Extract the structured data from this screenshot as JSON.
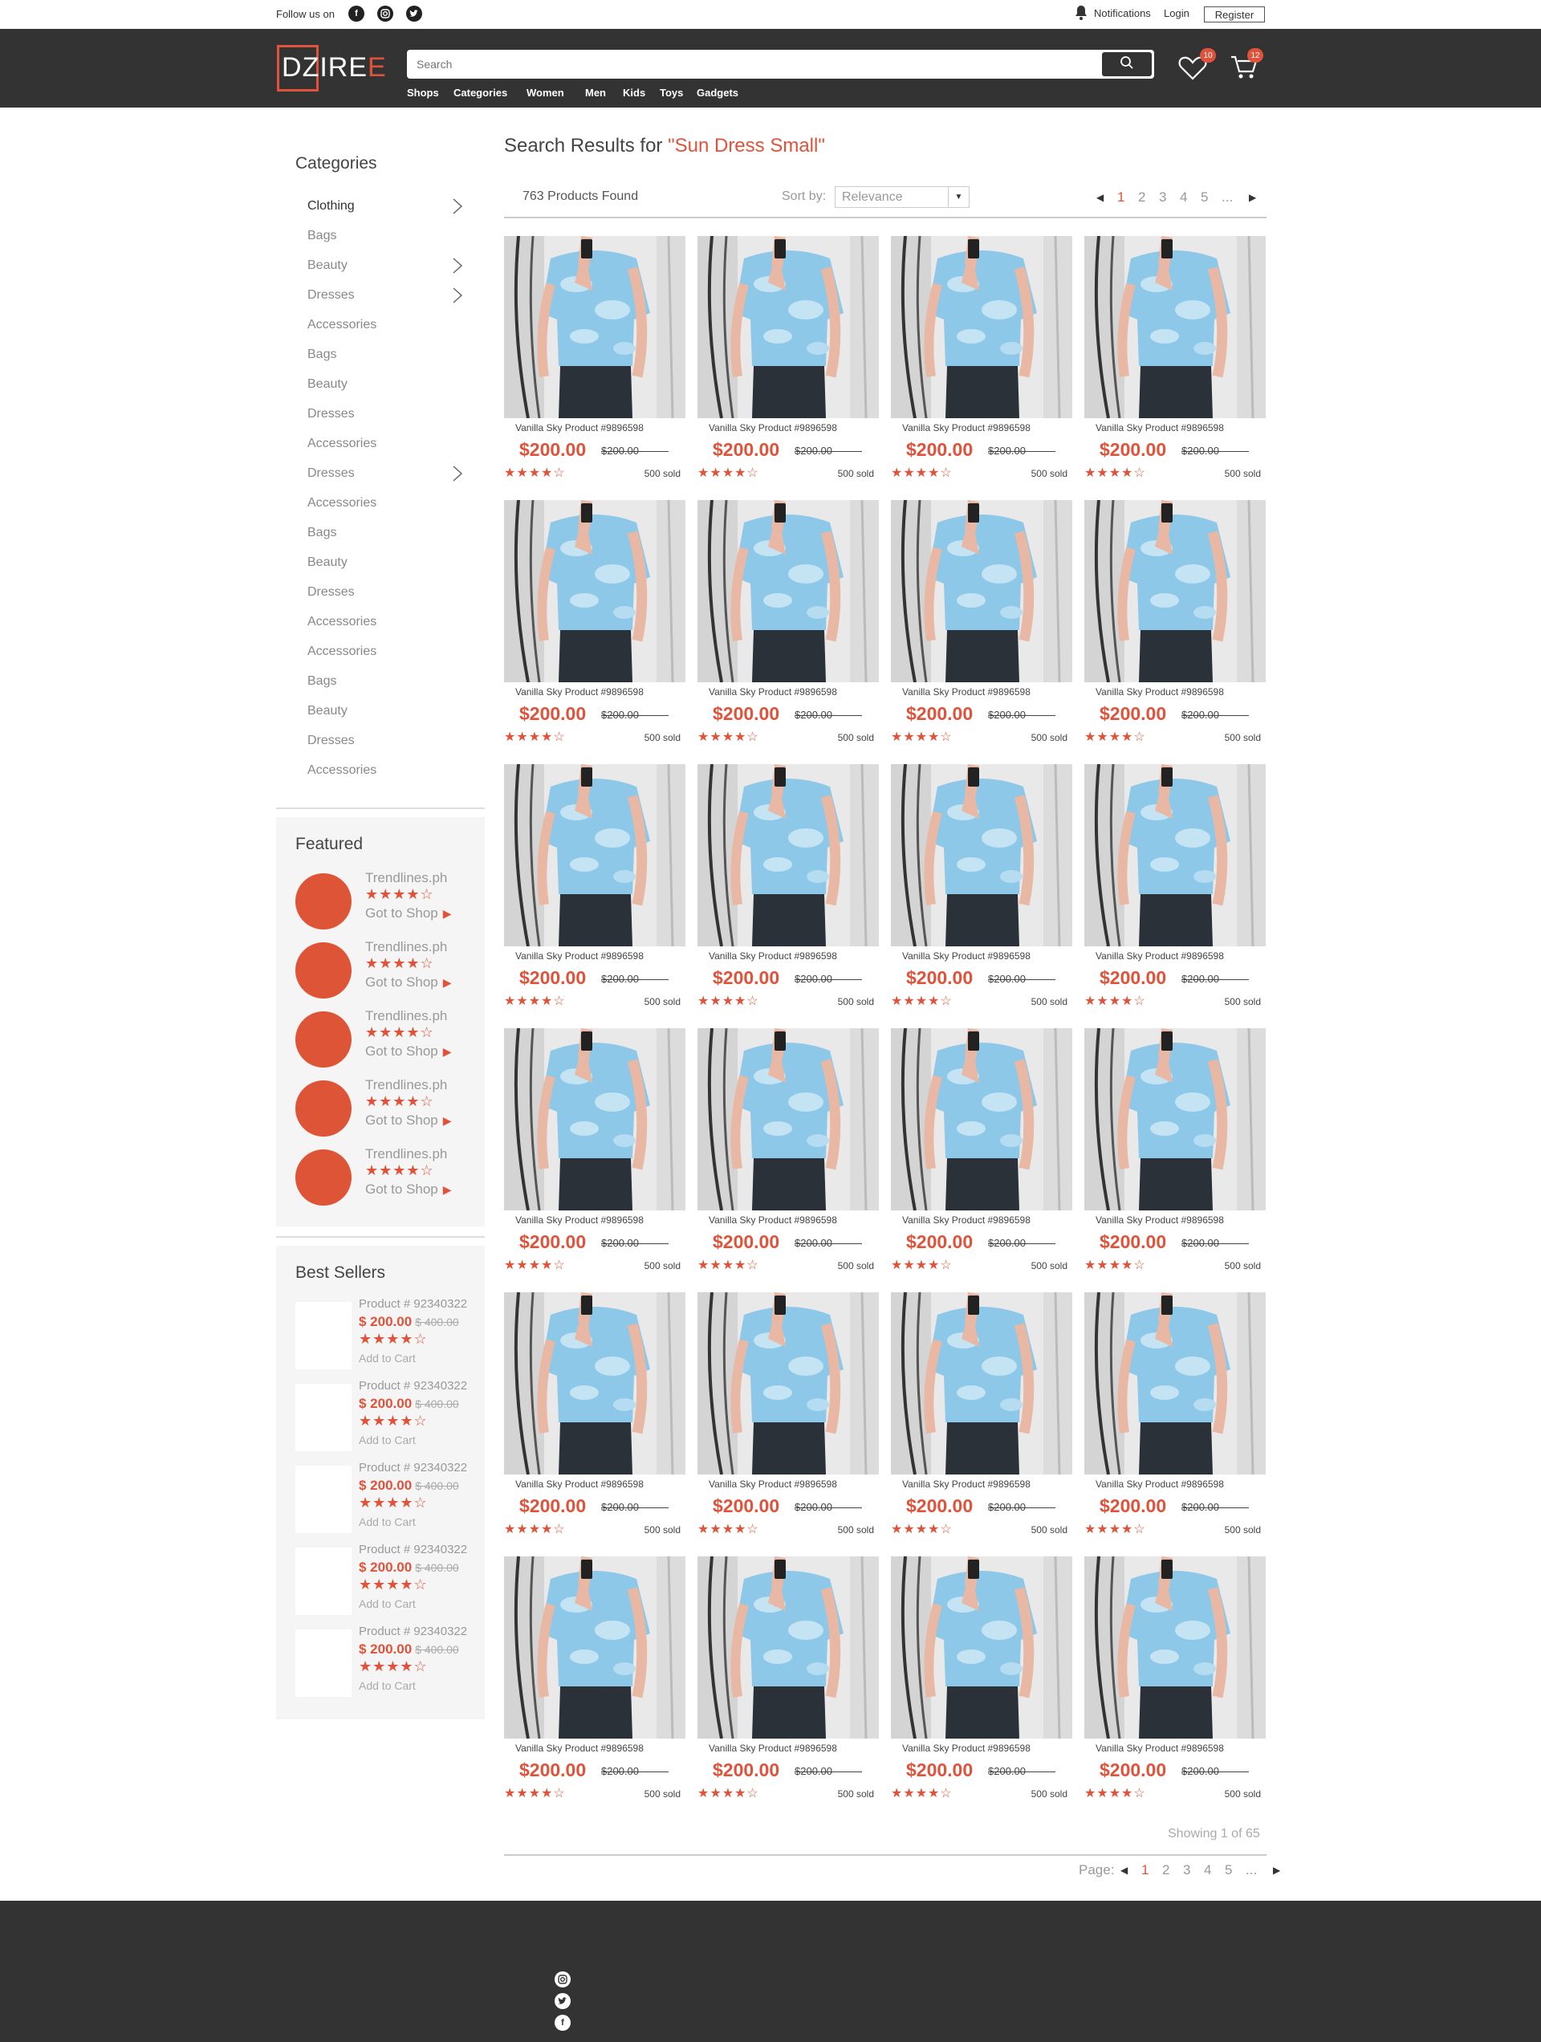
{
  "topbar": {
    "follow_label": "Follow us on",
    "social_icons": [
      "facebook-icon",
      "instagram-icon",
      "twitter-icon"
    ],
    "notifications": "Notifications",
    "login": "Login",
    "register": "Register"
  },
  "header": {
    "logo_main": "ZIRE",
    "logo_accent": "E",
    "logo_prefix": "D",
    "search_placeholder": "Search",
    "nav": [
      "Shops",
      "Categories",
      "Women",
      "Men",
      "Kids",
      "Toys",
      "Gadgets"
    ],
    "wishlist_count": "10",
    "cart_count": "12"
  },
  "colors": {
    "accent": "#e0533a",
    "header_bg": "#333333",
    "panel_bg": "#f5f5f5"
  },
  "sidebar": {
    "categories_title": "Categories",
    "categories": [
      {
        "label": "Clothing",
        "has_children": true,
        "active": true
      },
      {
        "label": "Bags",
        "has_children": false
      },
      {
        "label": "Beauty",
        "has_children": true
      },
      {
        "label": "Dresses",
        "has_children": true
      },
      {
        "label": "Accessories",
        "has_children": false
      },
      {
        "label": "Bags",
        "has_children": false
      },
      {
        "label": "Beauty",
        "has_children": false
      },
      {
        "label": "Dresses",
        "has_children": false
      },
      {
        "label": "Accessories",
        "has_children": false
      },
      {
        "label": "Dresses",
        "has_children": true
      },
      {
        "label": "Accessories",
        "has_children": false
      },
      {
        "label": "Bags",
        "has_children": false
      },
      {
        "label": "Beauty",
        "has_children": false
      },
      {
        "label": "Dresses",
        "has_children": false
      },
      {
        "label": "Accessories",
        "has_children": false
      },
      {
        "label": "Accessories",
        "has_children": false
      },
      {
        "label": "Bags",
        "has_children": false
      },
      {
        "label": "Beauty",
        "has_children": false
      },
      {
        "label": "Dresses",
        "has_children": false
      },
      {
        "label": "Accessories",
        "has_children": false
      }
    ],
    "featured_title": "Featured",
    "featured": [
      {
        "name": "Trendlines.ph",
        "rating": 4,
        "link": "Got to Shop"
      },
      {
        "name": "Trendlines.ph",
        "rating": 4,
        "link": "Got to Shop"
      },
      {
        "name": "Trendlines.ph",
        "rating": 4,
        "link": "Got to Shop"
      },
      {
        "name": "Trendlines.ph",
        "rating": 4,
        "link": "Got to Shop"
      },
      {
        "name": "Trendlines.ph",
        "rating": 4,
        "link": "Got to Shop"
      }
    ],
    "best_sellers_title": "Best Sellers",
    "best_sellers": [
      {
        "name": "Product # 92340322",
        "price": "$ 200.00",
        "old_price": "$ 400.00",
        "rating": 4,
        "action": "Add to Cart"
      },
      {
        "name": "Product # 92340322",
        "price": "$ 200.00",
        "old_price": "$ 400.00",
        "rating": 4,
        "action": "Add to Cart"
      },
      {
        "name": "Product # 92340322",
        "price": "$ 200.00",
        "old_price": "$ 400.00",
        "rating": 4,
        "action": "Add to Cart"
      },
      {
        "name": "Product # 92340322",
        "price": "$ 200.00",
        "old_price": "$ 400.00",
        "rating": 4,
        "action": "Add to Cart"
      },
      {
        "name": "Product # 92340322",
        "price": "$ 200.00",
        "old_price": "$ 400.00",
        "rating": 4,
        "action": "Add to Cart"
      }
    ]
  },
  "results": {
    "title_prefix": "Search Results for ",
    "query": "\"Sun Dress Small\"",
    "count": "763 Products Found",
    "sort_label": "Sort by:",
    "sort_value": "Relevance",
    "pages": [
      "1",
      "2",
      "3",
      "4",
      "5",
      "..."
    ],
    "current_page": "1",
    "showing": "Showing 1 of 65",
    "page_label": "Page:"
  },
  "product_template": {
    "name": "Vanilla Sky Product #9896598",
    "price": "$200.00",
    "old_price": "$200.00",
    "rating": 4,
    "sold": "500 sold"
  },
  "product_grid": {
    "rows": 6,
    "cols": 4
  },
  "footer": {
    "social_icons": [
      "instagram-icon",
      "twitter-icon",
      "facebook-icon"
    ]
  }
}
